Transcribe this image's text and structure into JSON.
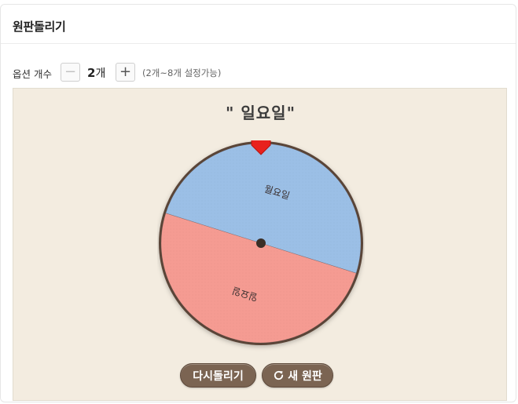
{
  "header": {
    "title": "원판돌리기"
  },
  "options": {
    "label": "옵션 개수",
    "minus_label": "−",
    "plus_label": "+",
    "count_value": "2",
    "count_unit": "개",
    "range_note": "(2개~8개 설정가능)"
  },
  "result": {
    "text": "\" 일요일\""
  },
  "wheel": {
    "segments": [
      {
        "label": "월요일",
        "color": "#9bbfe6",
        "fraction": 0.5
      },
      {
        "label": "일요일",
        "color": "#f59b92",
        "fraction": 0.5
      }
    ],
    "rim_color": "#5a4538",
    "pointer_color": "#e8211d"
  },
  "buttons": {
    "spin_label": "다시돌리기",
    "new_label": "새 원판"
  },
  "icons": {
    "refresh": "refresh-icon",
    "pointer": "pointer-icon"
  }
}
